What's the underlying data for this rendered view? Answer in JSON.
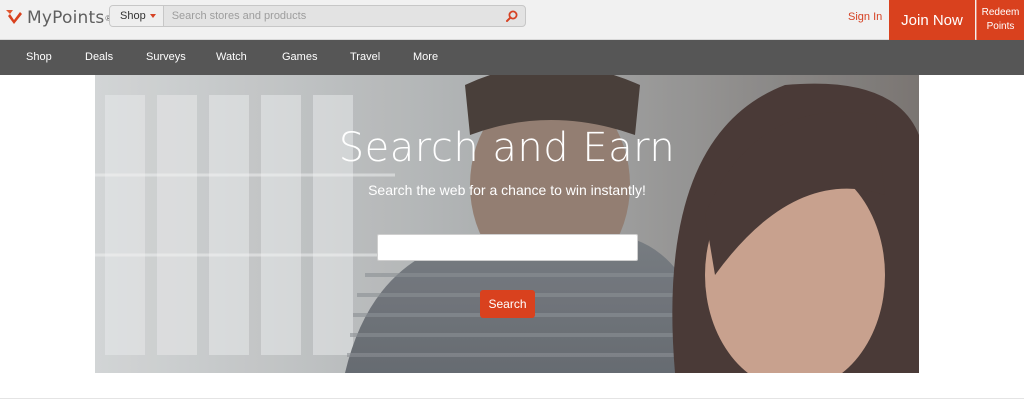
{
  "header": {
    "logo_text": "MyPoints",
    "logo_reg": "®",
    "shop_label": "Shop",
    "search_placeholder": "Search stores and products",
    "sign_in": "Sign In",
    "join_now": "Join Now",
    "redeem_line1": "Redeem",
    "redeem_line2": "Points"
  },
  "nav": {
    "items": [
      "Shop",
      "Deals",
      "Surveys",
      "Watch",
      "Games",
      "Travel",
      "More"
    ]
  },
  "hero": {
    "title": "Search and Earn",
    "subtitle": "Search the web for a chance to win instantly!",
    "search_value": "",
    "button_label": "Search"
  },
  "colors": {
    "brand": "#d9411e",
    "nav_bg": "#565656",
    "header_bg": "#f1f1f1"
  },
  "icons": {
    "logo": "mypoints-logo-icon",
    "search": "search-icon",
    "caret": "caret-down-icon"
  }
}
